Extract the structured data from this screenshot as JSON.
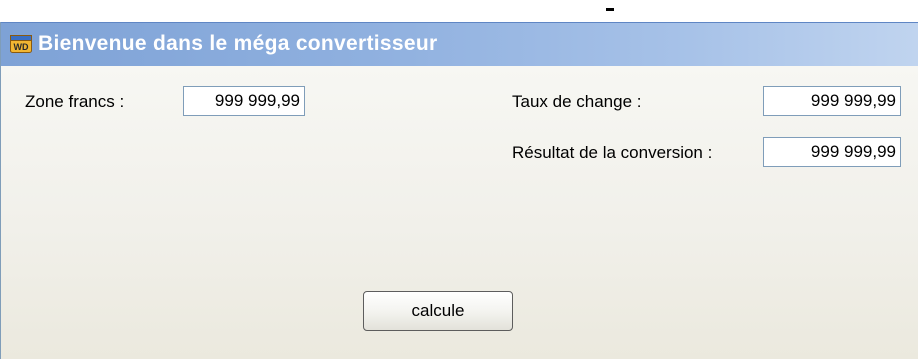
{
  "window": {
    "title": "Bienvenue dans le méga convertisseur",
    "icon": "windev-wd-icon"
  },
  "form": {
    "zone_francs_label": "Zone francs :",
    "zone_francs_value": "999 999,99",
    "taux_label": "Taux de change :",
    "taux_value": "999 999,99",
    "resultat_label": "Résultat de la conversion :",
    "resultat_value": "999 999,99",
    "calcule_label": "calcule"
  }
}
